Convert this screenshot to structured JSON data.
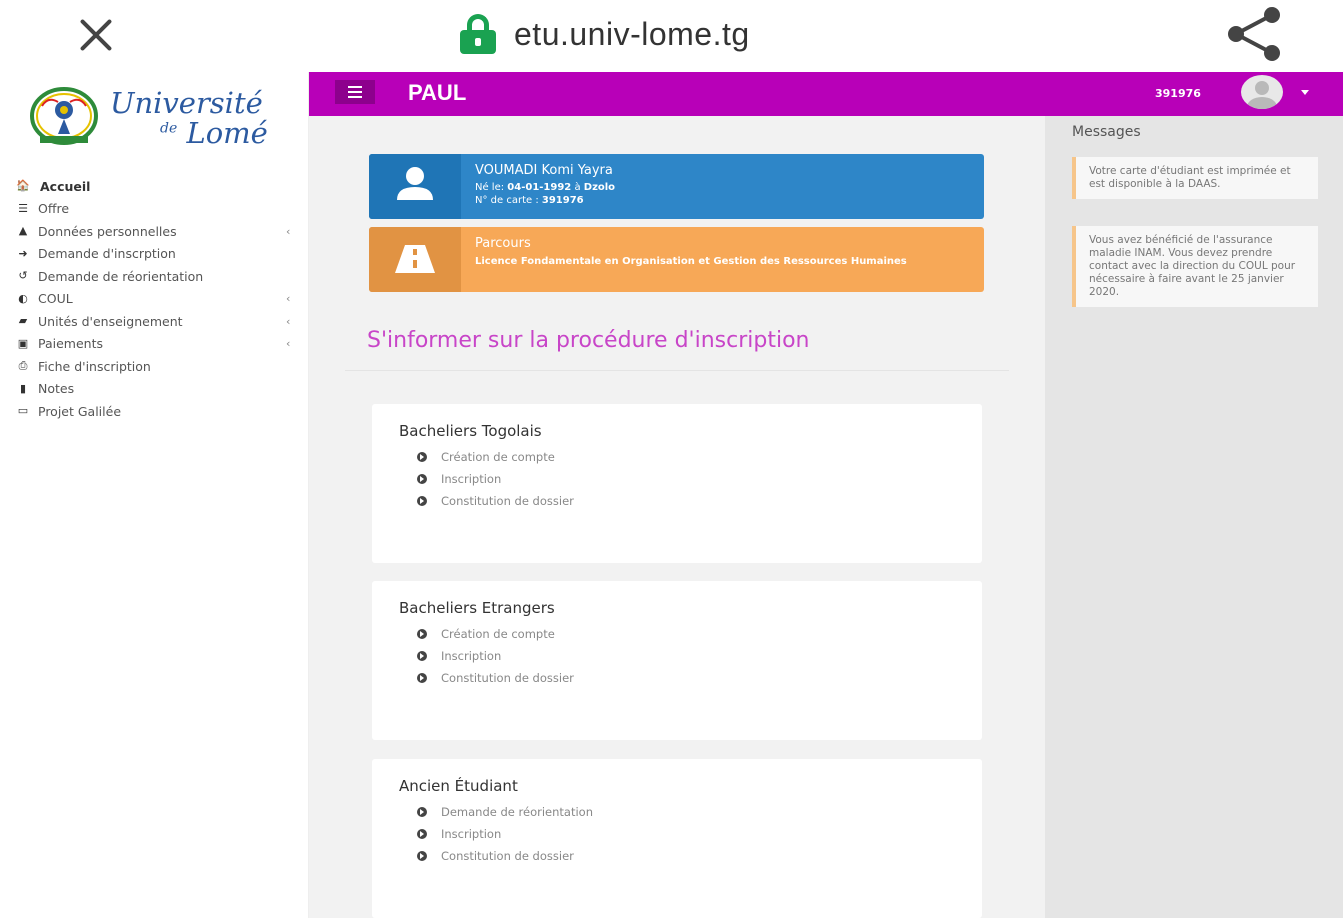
{
  "browser": {
    "url": "etu.univ-lome.tg",
    "close_icon": "close-icon",
    "lock_icon": "lock-icon",
    "share_icon": "share-icon"
  },
  "logo": {
    "line1": "Université",
    "line2_prefix": "de",
    "line2": "Lomé"
  },
  "sidebar": {
    "items": [
      {
        "label": "Accueil",
        "icon": "home-icon",
        "glyph": "🏠"
      },
      {
        "label": "Offre",
        "icon": "list-icon",
        "glyph": "☰"
      },
      {
        "label": "Données personnelles",
        "icon": "user-icon",
        "glyph": "▲"
      },
      {
        "label": "Demande d'inscrption",
        "icon": "sign-in-icon",
        "glyph": "➜"
      },
      {
        "label": "Demande de réorientation",
        "icon": "undo-icon",
        "glyph": "↺"
      },
      {
        "label": "COUL",
        "icon": "shield-icon",
        "glyph": "◐"
      },
      {
        "label": "Unités d'enseignement",
        "icon": "book-icon",
        "glyph": "▰"
      },
      {
        "label": "Paiements",
        "icon": "money-icon",
        "glyph": "▣"
      },
      {
        "label": "Fiche d'inscription",
        "icon": "print-icon",
        "glyph": "⎙"
      },
      {
        "label": "Notes",
        "icon": "bookmark-icon",
        "glyph": "▮"
      },
      {
        "label": "Projet Galilée",
        "icon": "laptop-icon",
        "glyph": "▭"
      }
    ],
    "caret": "‹"
  },
  "topbar": {
    "name": "PAUL",
    "student_id": "391976",
    "color": "#b800b8"
  },
  "student_card": {
    "name": "VOUMADI Komi Yayra",
    "born_label": "Né le: ",
    "born_date": "04-01-1992",
    "born_at": " à ",
    "born_place": "Dzolo",
    "card_label": "N° de carte : ",
    "card_number": "391976",
    "color": "#2e86c8"
  },
  "parcours_card": {
    "title": "Parcours",
    "program": "Licence Fondamentale en Organisation et Gestion des Ressources Humaines",
    "color": "#f7a857"
  },
  "procedure": {
    "title": "S'informer sur la procédure d'inscription",
    "sections": [
      {
        "title": "Bacheliers Togolais",
        "items": [
          "Création de compte",
          "Inscription",
          "Constitution de dossier"
        ]
      },
      {
        "title": "Bacheliers Etrangers",
        "items": [
          "Création de compte",
          "Inscription",
          "Constitution de dossier"
        ]
      },
      {
        "title": "Ancien Étudiant",
        "items": [
          "Demande de réorientation",
          "Inscription",
          "Constitution de dossier"
        ]
      }
    ]
  },
  "messages": {
    "title": "Messages",
    "items": [
      "Votre carte d'étudiant est imprimée et est disponible à la DAAS.",
      "Vous avez bénéficié de l'assurance maladie INAM. Vous devez prendre contact avec la direction du COUL pour nécessaire à faire avant le 25 janvier 2020."
    ]
  }
}
